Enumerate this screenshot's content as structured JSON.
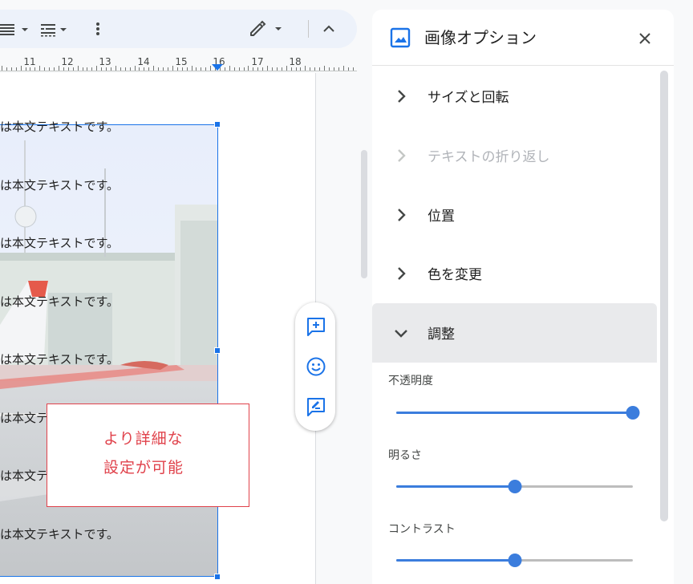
{
  "ruler": {
    "numbers": [
      "11",
      "12",
      "13",
      "14",
      "15",
      "16",
      "17",
      "18"
    ]
  },
  "document": {
    "body_line_text": "は本文テキストです。",
    "image_description": "photo"
  },
  "callout": {
    "line1": "より詳細な",
    "line2": "設定が可能"
  },
  "panel": {
    "title": "画像オプション",
    "sections": [
      {
        "label": "サイズと回転",
        "enabled": true,
        "expanded": false
      },
      {
        "label": "テキストの折り返し",
        "enabled": false,
        "expanded": false
      },
      {
        "label": "位置",
        "enabled": true,
        "expanded": false
      },
      {
        "label": "色を変更",
        "enabled": true,
        "expanded": false
      },
      {
        "label": "調整",
        "enabled": true,
        "expanded": true
      }
    ],
    "adjustments": {
      "opacity": {
        "label": "不透明度",
        "value": 1.0
      },
      "brightness": {
        "label": "明るさ",
        "value": 0.5
      },
      "contrast": {
        "label": "コントラスト",
        "value": 0.5
      }
    }
  },
  "colors": {
    "accent": "#1a73e8",
    "slider": "#3b7ddd",
    "callout": "#e0424b"
  }
}
